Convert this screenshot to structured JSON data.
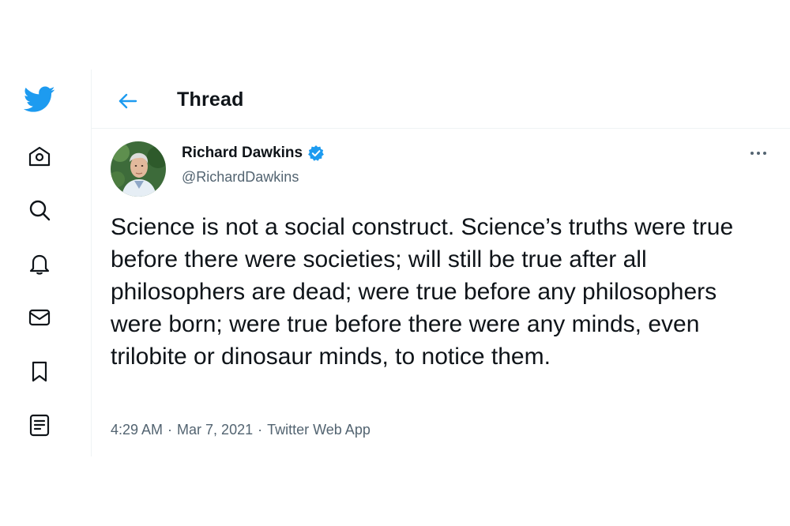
{
  "sidebar": {
    "items": [
      {
        "name": "twitter-logo-icon"
      },
      {
        "name": "home-icon"
      },
      {
        "name": "explore-search-icon"
      },
      {
        "name": "notifications-bell-icon"
      },
      {
        "name": "messages-envelope-icon"
      },
      {
        "name": "bookmarks-icon"
      },
      {
        "name": "lists-icon"
      }
    ]
  },
  "header": {
    "back_icon": "arrow-left-icon",
    "title": "Thread"
  },
  "tweet": {
    "author_name": "Richard Dawkins",
    "verified": true,
    "handle": "@RichardDawkins",
    "text": "Science is not a social construct. Science’s truths were true before there were societies; will still be true after all philosophers are dead; were true before any philosophers were born; were true before there were any minds, even trilobite or dinosaur minds, to notice them.",
    "time": "4:29 AM",
    "date": "Mar 7, 2021",
    "source": "Twitter Web App",
    "separator": "·"
  },
  "colors": {
    "brand": "#1d9bf0",
    "text": "#0f1419",
    "secondary": "#536471",
    "border": "#eff3f4"
  }
}
